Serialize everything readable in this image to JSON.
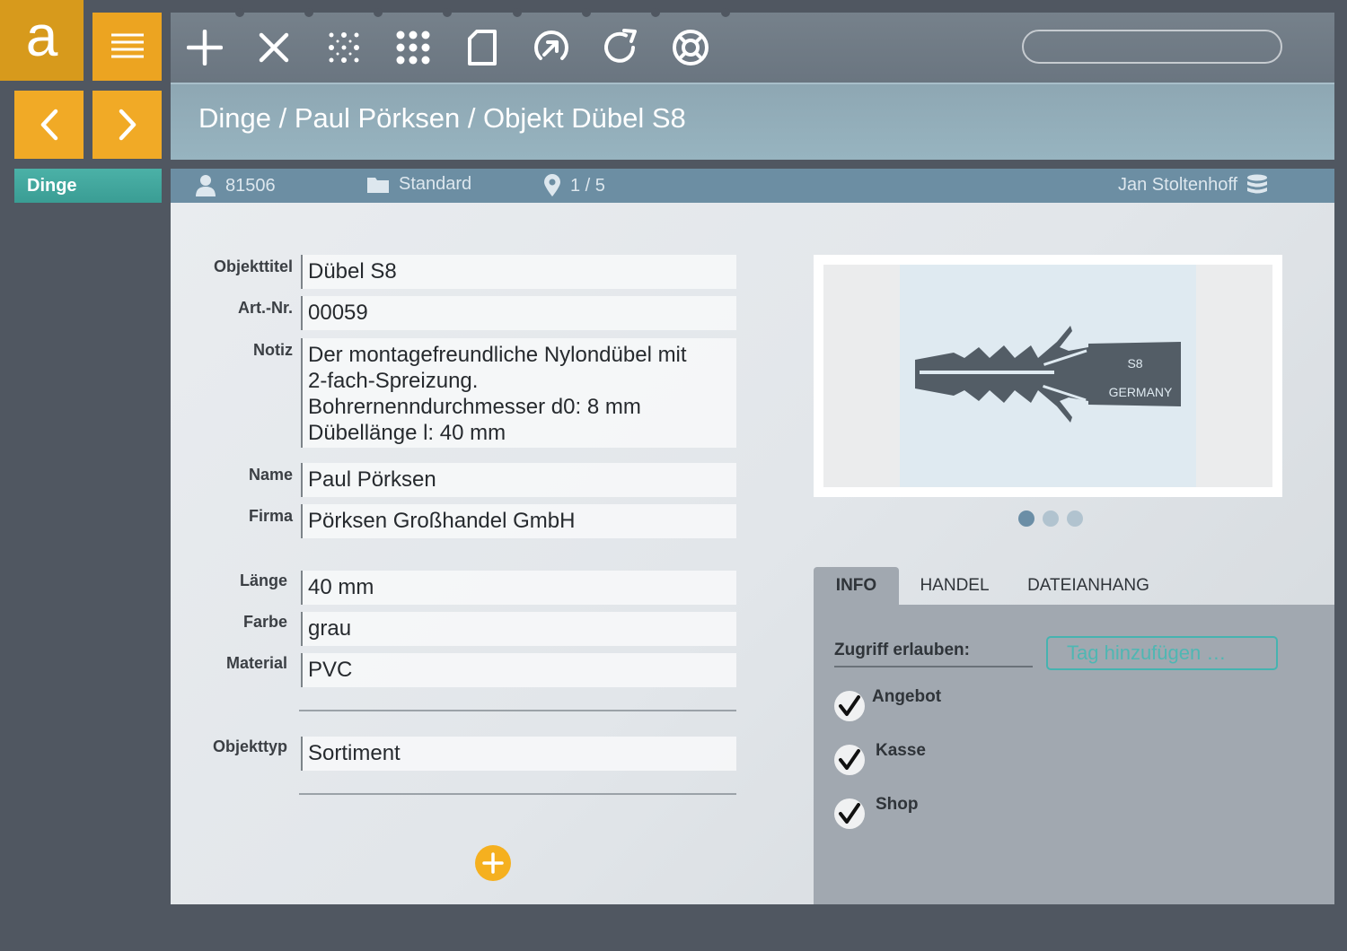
{
  "app": {
    "logo_letter": "a"
  },
  "sidebar": {
    "items": [
      {
        "label": "Dinge"
      }
    ]
  },
  "search": {
    "placeholder": "",
    "value": ""
  },
  "breadcrumb": "Dinge / Paul Pörksen / Objekt Dübel S8",
  "info_bar": {
    "id": "81506",
    "folder": "Standard",
    "position": "1 / 5",
    "user": "Jan Stoltenhoff"
  },
  "fields": {
    "objekttitel": {
      "label": "Objekttitel",
      "value": "Dübel S8"
    },
    "artnr": {
      "label": "Art.-Nr.",
      "value": "00059"
    },
    "notiz": {
      "label": "Notiz",
      "lines": [
        "Der montagefreundliche Nylondübel mit",
        "2-fach-Spreizung.",
        "Bohrernenndurchmesser d0: 8 mm",
        "Dübellänge l: 40 mm"
      ]
    },
    "name": {
      "label": "Name",
      "value": "Paul Pörksen"
    },
    "firma": {
      "label": "Firma",
      "value": "Pörksen Großhandel GmbH"
    },
    "laenge": {
      "label": "Länge",
      "value": "40 mm"
    },
    "farbe": {
      "label": "Farbe",
      "value": "grau"
    },
    "material": {
      "label": "Material",
      "value": "PVC"
    },
    "objekttyp": {
      "label": "Objekttyp",
      "value": "Sortiment"
    }
  },
  "image": {
    "text_top": "S8",
    "text_bottom": "GERMANY",
    "pages": 3,
    "active_page": 1
  },
  "tabs": [
    {
      "label": "INFO"
    },
    {
      "label": "HANDEL"
    },
    {
      "label": "DATEIANHANG"
    }
  ],
  "info_panel": {
    "access_label": "Zugriff erlauben:",
    "tag_placeholder": "Tag hinzufügen …",
    "checks": [
      {
        "label": "Angebot",
        "checked": true
      },
      {
        "label": "Kasse",
        "checked": true
      },
      {
        "label": "Shop",
        "checked": true
      }
    ]
  },
  "colors": {
    "accent_orange": "#f1aa26",
    "accent_teal": "#46b3b0",
    "header_blue": "#6c8ea3"
  }
}
